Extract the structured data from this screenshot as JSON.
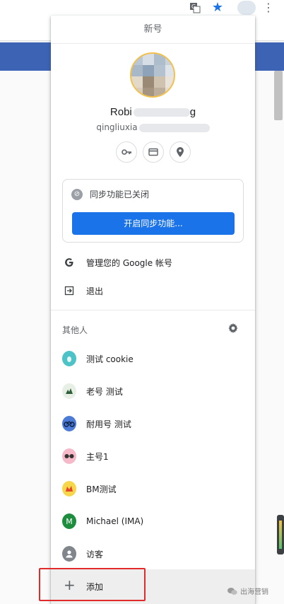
{
  "menu": {
    "title": "新号",
    "user": {
      "name": "Robi",
      "name_tail": "g",
      "email_prefix": "qingliuxia"
    },
    "quick_actions": [
      "key-icon",
      "credit-card-icon",
      "location-pin-icon"
    ],
    "sync": {
      "status": "同步功能已关闭",
      "button": "开启同步功能..."
    },
    "account_items": [
      {
        "icon": "google-g-icon",
        "label": "管理您的 Google 帐号"
      },
      {
        "icon": "sign-out-icon",
        "label": "退出"
      }
    ],
    "others_title": "其他人",
    "people": [
      {
        "label": "测试 cookie",
        "avatar_color": "#4dc3c8"
      },
      {
        "label": "老号 测试",
        "avatar_color": "#e8f0e6"
      },
      {
        "label": "耐用号 测试",
        "avatar_color": "#4b7bd6"
      },
      {
        "label": "主号1",
        "avatar_color": "#f5b9c9"
      },
      {
        "label": "BM测试",
        "avatar_color": "#f6d64a"
      },
      {
        "label": "Michael (IMA)",
        "avatar_color": "#1e8e3e",
        "initial": "M"
      },
      {
        "label": "访客",
        "avatar_color": "#80868b"
      }
    ],
    "add_label": "添加"
  },
  "watermark": "出海营销",
  "colors": {
    "accent": "#1a73e8",
    "highlight": "#e12b2b",
    "browser_bar": "#3d63b4"
  }
}
